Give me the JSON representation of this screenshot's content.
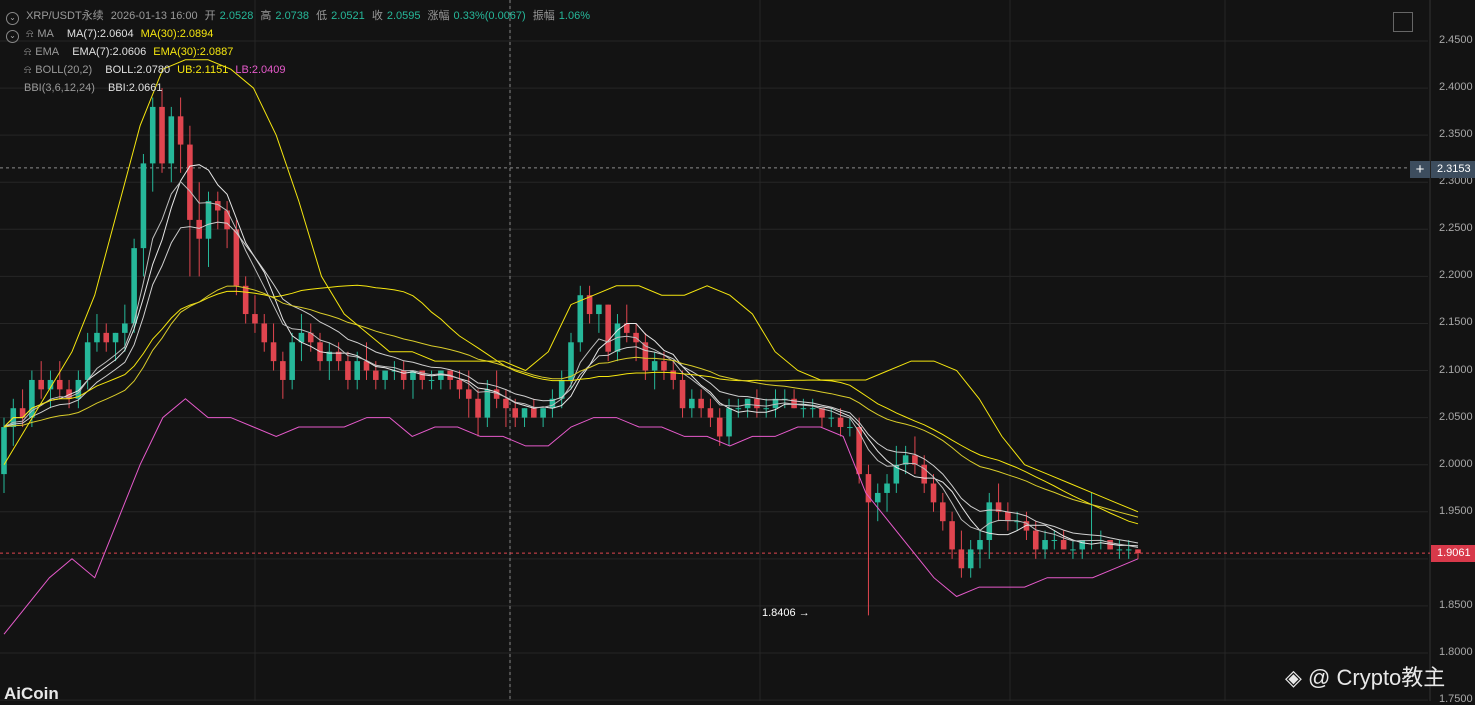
{
  "header": {
    "symbol": "XRP/USDT永续",
    "datetime": "2026-01-13 16:00",
    "open_label": "开",
    "open": "2.0528",
    "high_label": "高",
    "high": "2.0738",
    "low_label": "低",
    "low": "2.0521",
    "close_label": "收",
    "close": "2.0595",
    "change_label": "涨幅",
    "change": "0.33%(0.0067)",
    "amplitude_label": "振幅",
    "amplitude": "1.06%"
  },
  "indicators": {
    "ma": {
      "name": "MA",
      "ma7": "MA(7):2.0604",
      "ma30": "MA(30):2.0894"
    },
    "ema": {
      "name": "EMA",
      "ema7": "EMA(7):2.0606",
      "ema30": "EMA(30):2.0887"
    },
    "boll": {
      "name": "BOLL(20,2)",
      "mid": "BOLL:2.0780",
      "ub": "UB:2.1151",
      "lb": "LB:2.0409"
    },
    "bbi": {
      "name": "BBI(3,6,12,24)",
      "value": "BBI:2.0661"
    }
  },
  "price_axis": {
    "ticks": [
      "2.4500",
      "2.4000",
      "2.3500",
      "2.3000",
      "2.2500",
      "2.2000",
      "2.1500",
      "2.1000",
      "2.0500",
      "2.0000",
      "1.9500",
      "1.9000",
      "1.8500",
      "1.8000",
      "1.7500"
    ],
    "crosshair_price": "2.3153",
    "current_price": "1.9061"
  },
  "min_label": "1.8406 →",
  "watermark": "@ Crypto教主",
  "logo": "AiCoin",
  "colors": {
    "up": "#26b89a",
    "down": "#e0454f",
    "boll": "#f5e60f",
    "lb": "#e65acb",
    "ma": "#d8d8d8",
    "bg": "#131313",
    "grid": "#262626"
  },
  "chart_data": {
    "type": "candlestick",
    "ylim": [
      1.75,
      2.47
    ],
    "candles": [
      [
        1.99,
        2.05,
        1.97,
        2.04
      ],
      [
        2.04,
        2.07,
        2.02,
        2.06
      ],
      [
        2.06,
        2.08,
        2.04,
        2.05
      ],
      [
        2.05,
        2.1,
        2.04,
        2.09
      ],
      [
        2.09,
        2.11,
        2.07,
        2.08
      ],
      [
        2.08,
        2.1,
        2.06,
        2.09
      ],
      [
        2.09,
        2.11,
        2.07,
        2.08
      ],
      [
        2.08,
        2.09,
        2.06,
        2.07
      ],
      [
        2.07,
        2.1,
        2.06,
        2.09
      ],
      [
        2.09,
        2.14,
        2.08,
        2.13
      ],
      [
        2.13,
        2.16,
        2.12,
        2.14
      ],
      [
        2.14,
        2.15,
        2.12,
        2.13
      ],
      [
        2.13,
        2.14,
        2.11,
        2.14
      ],
      [
        2.14,
        2.17,
        2.12,
        2.15
      ],
      [
        2.15,
        2.24,
        2.14,
        2.23
      ],
      [
        2.23,
        2.33,
        2.2,
        2.32
      ],
      [
        2.32,
        2.39,
        2.29,
        2.38
      ],
      [
        2.38,
        2.4,
        2.31,
        2.32
      ],
      [
        2.32,
        2.38,
        2.3,
        2.37
      ],
      [
        2.37,
        2.39,
        2.31,
        2.34
      ],
      [
        2.34,
        2.36,
        2.2,
        2.26
      ],
      [
        2.26,
        2.3,
        2.2,
        2.24
      ],
      [
        2.24,
        2.29,
        2.21,
        2.28
      ],
      [
        2.28,
        2.29,
        2.25,
        2.27
      ],
      [
        2.27,
        2.28,
        2.23,
        2.25
      ],
      [
        2.25,
        2.26,
        2.18,
        2.19
      ],
      [
        2.19,
        2.2,
        2.15,
        2.16
      ],
      [
        2.16,
        2.18,
        2.14,
        2.15
      ],
      [
        2.15,
        2.16,
        2.12,
        2.13
      ],
      [
        2.13,
        2.15,
        2.1,
        2.11
      ],
      [
        2.11,
        2.12,
        2.07,
        2.09
      ],
      [
        2.09,
        2.14,
        2.08,
        2.13
      ],
      [
        2.13,
        2.16,
        2.11,
        2.14
      ],
      [
        2.14,
        2.15,
        2.12,
        2.13
      ],
      [
        2.13,
        2.14,
        2.1,
        2.11
      ],
      [
        2.11,
        2.13,
        2.09,
        2.12
      ],
      [
        2.12,
        2.13,
        2.1,
        2.11
      ],
      [
        2.11,
        2.12,
        2.08,
        2.09
      ],
      [
        2.09,
        2.12,
        2.08,
        2.11
      ],
      [
        2.11,
        2.13,
        2.09,
        2.1
      ],
      [
        2.1,
        2.11,
        2.08,
        2.09
      ],
      [
        2.09,
        2.1,
        2.08,
        2.1
      ],
      [
        2.1,
        2.11,
        2.09,
        2.1
      ],
      [
        2.1,
        2.11,
        2.08,
        2.09
      ],
      [
        2.09,
        2.1,
        2.07,
        2.1
      ],
      [
        2.1,
        2.1,
        2.08,
        2.09
      ],
      [
        2.09,
        2.1,
        2.08,
        2.09
      ],
      [
        2.09,
        2.1,
        2.08,
        2.1
      ],
      [
        2.1,
        2.1,
        2.08,
        2.09
      ],
      [
        2.09,
        2.1,
        2.07,
        2.08
      ],
      [
        2.08,
        2.1,
        2.05,
        2.07
      ],
      [
        2.07,
        2.08,
        2.03,
        2.05
      ],
      [
        2.05,
        2.09,
        2.04,
        2.08
      ],
      [
        2.08,
        2.1,
        2.06,
        2.07
      ],
      [
        2.07,
        2.08,
        2.04,
        2.06
      ],
      [
        2.06,
        2.07,
        2.04,
        2.05
      ],
      [
        2.05,
        2.06,
        2.04,
        2.06
      ],
      [
        2.06,
        2.07,
        2.05,
        2.05
      ],
      [
        2.05,
        2.06,
        2.04,
        2.06
      ],
      [
        2.06,
        2.08,
        2.05,
        2.07
      ],
      [
        2.07,
        2.1,
        2.06,
        2.09
      ],
      [
        2.09,
        2.14,
        2.08,
        2.13
      ],
      [
        2.13,
        2.19,
        2.12,
        2.18
      ],
      [
        2.18,
        2.19,
        2.15,
        2.16
      ],
      [
        2.16,
        2.17,
        2.14,
        2.17
      ],
      [
        2.17,
        2.17,
        2.11,
        2.12
      ],
      [
        2.12,
        2.16,
        2.11,
        2.15
      ],
      [
        2.15,
        2.17,
        2.13,
        2.14
      ],
      [
        2.14,
        2.15,
        2.11,
        2.13
      ],
      [
        2.13,
        2.14,
        2.09,
        2.1
      ],
      [
        2.1,
        2.12,
        2.08,
        2.11
      ],
      [
        2.11,
        2.12,
        2.09,
        2.1
      ],
      [
        2.1,
        2.11,
        2.08,
        2.09
      ],
      [
        2.09,
        2.1,
        2.05,
        2.06
      ],
      [
        2.06,
        2.08,
        2.05,
        2.07
      ],
      [
        2.07,
        2.08,
        2.05,
        2.06
      ],
      [
        2.06,
        2.07,
        2.04,
        2.05
      ],
      [
        2.05,
        2.06,
        2.02,
        2.03
      ],
      [
        2.03,
        2.07,
        2.02,
        2.06
      ],
      [
        2.06,
        2.07,
        2.05,
        2.06
      ],
      [
        2.06,
        2.07,
        2.05,
        2.07
      ],
      [
        2.07,
        2.08,
        2.05,
        2.06
      ],
      [
        2.06,
        2.07,
        2.05,
        2.06
      ],
      [
        2.06,
        2.08,
        2.05,
        2.07
      ],
      [
        2.07,
        2.08,
        2.06,
        2.07
      ],
      [
        2.07,
        2.08,
        2.06,
        2.06
      ],
      [
        2.06,
        2.07,
        2.05,
        2.06
      ],
      [
        2.06,
        2.07,
        2.05,
        2.06
      ],
      [
        2.06,
        2.06,
        2.04,
        2.05
      ],
      [
        2.05,
        2.06,
        2.04,
        2.05
      ],
      [
        2.05,
        2.06,
        2.03,
        2.04
      ],
      [
        2.04,
        2.05,
        2.03,
        2.04
      ],
      [
        2.04,
        2.05,
        1.98,
        1.99
      ],
      [
        1.99,
        2.0,
        1.84,
        1.96
      ],
      [
        1.96,
        1.98,
        1.94,
        1.97
      ],
      [
        1.97,
        1.99,
        1.95,
        1.98
      ],
      [
        1.98,
        2.02,
        1.97,
        2.0
      ],
      [
        2.0,
        2.02,
        1.99,
        2.01
      ],
      [
        2.01,
        2.03,
        1.99,
        2.0
      ],
      [
        2.0,
        2.01,
        1.97,
        1.98
      ],
      [
        1.98,
        1.99,
        1.95,
        1.96
      ],
      [
        1.96,
        1.97,
        1.93,
        1.94
      ],
      [
        1.94,
        1.95,
        1.9,
        1.91
      ],
      [
        1.91,
        1.93,
        1.88,
        1.89
      ],
      [
        1.89,
        1.92,
        1.88,
        1.91
      ],
      [
        1.91,
        1.93,
        1.89,
        1.92
      ],
      [
        1.92,
        1.97,
        1.9,
        1.96
      ],
      [
        1.96,
        1.98,
        1.94,
        1.95
      ],
      [
        1.95,
        1.96,
        1.93,
        1.94
      ],
      [
        1.94,
        1.95,
        1.93,
        1.94
      ],
      [
        1.94,
        1.95,
        1.92,
        1.93
      ],
      [
        1.93,
        1.94,
        1.9,
        1.91
      ],
      [
        1.91,
        1.93,
        1.9,
        1.92
      ],
      [
        1.92,
        1.93,
        1.91,
        1.92
      ],
      [
        1.92,
        1.93,
        1.91,
        1.91
      ],
      [
        1.91,
        1.92,
        1.9,
        1.91
      ],
      [
        1.91,
        1.92,
        1.9,
        1.92
      ],
      [
        1.92,
        1.97,
        1.91,
        1.92
      ],
      [
        1.92,
        1.93,
        1.91,
        1.92
      ],
      [
        1.92,
        1.92,
        1.91,
        1.91
      ],
      [
        1.91,
        1.92,
        1.9,
        1.91
      ],
      [
        1.91,
        1.92,
        1.9,
        1.91
      ],
      [
        1.91,
        1.91,
        1.9,
        1.906
      ]
    ],
    "boll_ub": [
      2.0,
      2.04,
      2.08,
      2.12,
      2.18,
      2.27,
      2.36,
      2.42,
      2.43,
      2.43,
      2.42,
      2.4,
      2.35,
      2.28,
      2.2,
      2.16,
      2.14,
      2.12,
      2.12,
      2.11,
      2.11,
      2.11,
      2.11,
      2.1,
      2.12,
      2.17,
      2.18,
      2.19,
      2.19,
      2.18,
      2.18,
      2.19,
      2.18,
      2.16,
      2.12,
      2.1,
      2.09,
      2.09,
      2.09,
      2.1,
      2.11,
      2.11,
      2.1,
      2.07,
      2.03,
      2.0,
      1.99,
      1.98,
      1.97,
      1.96,
      1.95
    ],
    "boll_lb": [
      1.82,
      1.85,
      1.88,
      1.9,
      1.88,
      1.94,
      2.0,
      2.05,
      2.07,
      2.05,
      2.05,
      2.04,
      2.03,
      2.04,
      2.04,
      2.04,
      2.05,
      2.05,
      2.03,
      2.04,
      2.04,
      2.03,
      2.03,
      2.02,
      2.02,
      2.04,
      2.05,
      2.05,
      2.04,
      2.04,
      2.03,
      2.03,
      2.02,
      2.03,
      2.03,
      2.04,
      2.04,
      2.03,
      1.97,
      1.94,
      1.91,
      1.88,
      1.86,
      1.87,
      1.87,
      1.87,
      1.88,
      1.88,
      1.88,
      1.89,
      1.9
    ],
    "boll_mid": [
      1.91,
      1.95,
      1.99,
      2.03,
      2.06,
      2.1,
      2.15,
      2.18,
      2.19,
      2.19,
      2.18,
      2.17,
      2.15,
      2.13,
      2.11,
      2.1,
      2.1,
      2.09,
      2.08,
      2.08,
      2.07,
      2.07,
      2.07,
      2.08,
      2.09,
      2.1,
      2.11,
      2.11,
      2.11,
      2.1,
      2.1,
      2.1,
      2.1,
      2.09,
      2.08,
      2.07,
      2.06,
      2.05,
      2.04,
      2.02,
      2.0,
      1.98,
      1.97,
      1.96,
      1.95,
      1.94,
      1.93,
      1.93,
      1.93,
      1.92,
      1.92
    ]
  }
}
